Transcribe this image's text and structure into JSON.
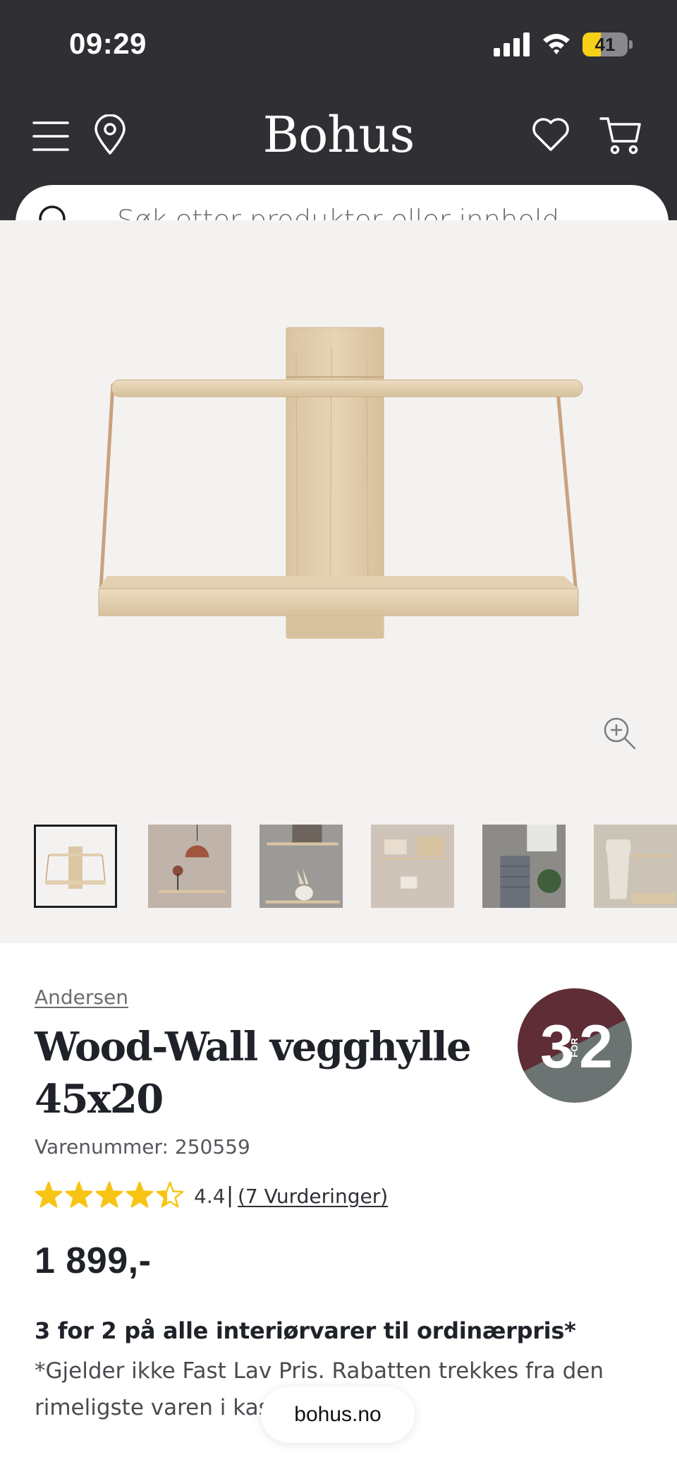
{
  "status_bar": {
    "time": "09:29",
    "battery_level": "41",
    "battery_fraction": 0.41
  },
  "header": {
    "logo": "Bohus",
    "icons": [
      "menu-icon",
      "location-icon",
      "heart-icon",
      "cart-icon"
    ]
  },
  "search": {
    "placeholder": "Søk etter produkter eller innhold..."
  },
  "gallery": {
    "thumbnail_count": 6,
    "active_index": 0
  },
  "product": {
    "brand": "Andersen",
    "title": "Wood-Wall vegghylle 45x20",
    "article_number": "Varenummer: 250559",
    "rating_value": "4.4",
    "rating_stars": 4.4,
    "rating_separator": "|",
    "reviews_link": "(7 Vurderinger)",
    "price": "1 899,-",
    "badge": {
      "left": "3",
      "middle": "FOR",
      "right": "2",
      "colors": {
        "top": "#5e2d35",
        "bottom": "#6b7473"
      }
    }
  },
  "promotion": {
    "title": "3 for 2 på alle interiørvarer til ordinærpris*",
    "text": "*Gjelder ikke Fast Lav Pris. Rabatten trekkes fra den rimeligste varen i kassen."
  },
  "browser": {
    "domain": "bohus.no"
  },
  "colors": {
    "header_bg": "#302f34",
    "gallery_bg": "#f4f2f1",
    "star": "#f8c413",
    "text": "#1f2229"
  }
}
